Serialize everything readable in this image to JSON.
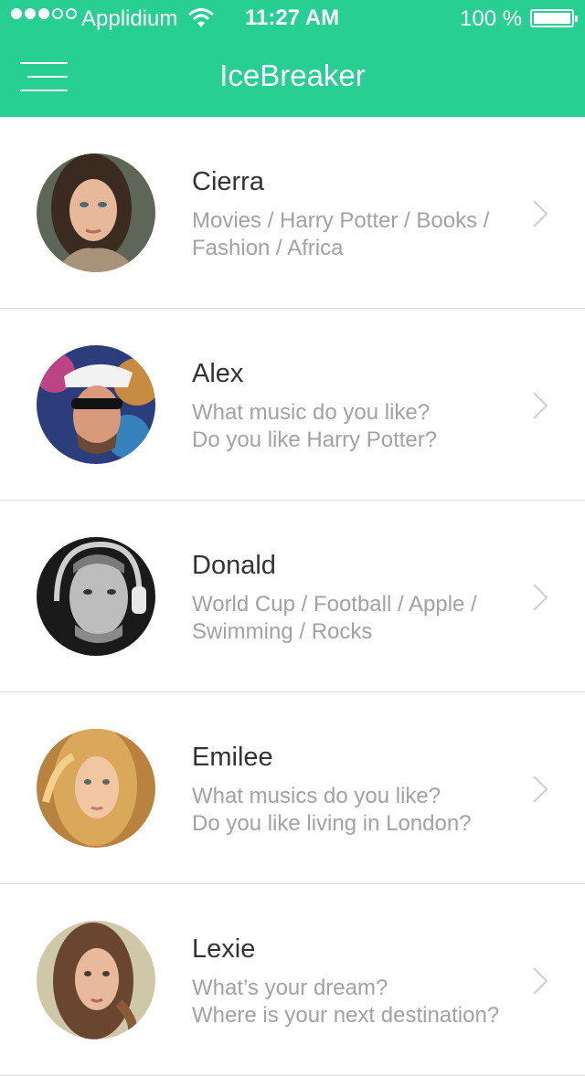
{
  "status_bar": {
    "carrier": "Applidium",
    "time": "11:27 AM",
    "battery": "100 %",
    "signal_bars_filled": 3,
    "signal_bars_total": 5
  },
  "nav": {
    "title": "IceBreaker",
    "menu_icon": "hamburger-menu-icon"
  },
  "colors": {
    "accent": "#27cf93",
    "name_text": "#333333",
    "secondary_text": "#a2a2a2",
    "divider": "#dcdcdc",
    "chevron": "#cfcfcf"
  },
  "contacts": [
    {
      "name": "Cierra",
      "line1": "Movies / Harry Potter / Books /",
      "line2": "Fashion / Africa"
    },
    {
      "name": "Alex",
      "line1": "What music do you like?",
      "line2": "Do you like Harry Potter?"
    },
    {
      "name": "Donald",
      "line1": "World Cup / Football / Apple /",
      "line2": "Swimming / Rocks"
    },
    {
      "name": "Emilee",
      "line1": "What musics do you like?",
      "line2": "Do you like living in London?"
    },
    {
      "name": "Lexie",
      "line1": "What’s your dream?",
      "line2": "Where is your next destination?"
    }
  ]
}
